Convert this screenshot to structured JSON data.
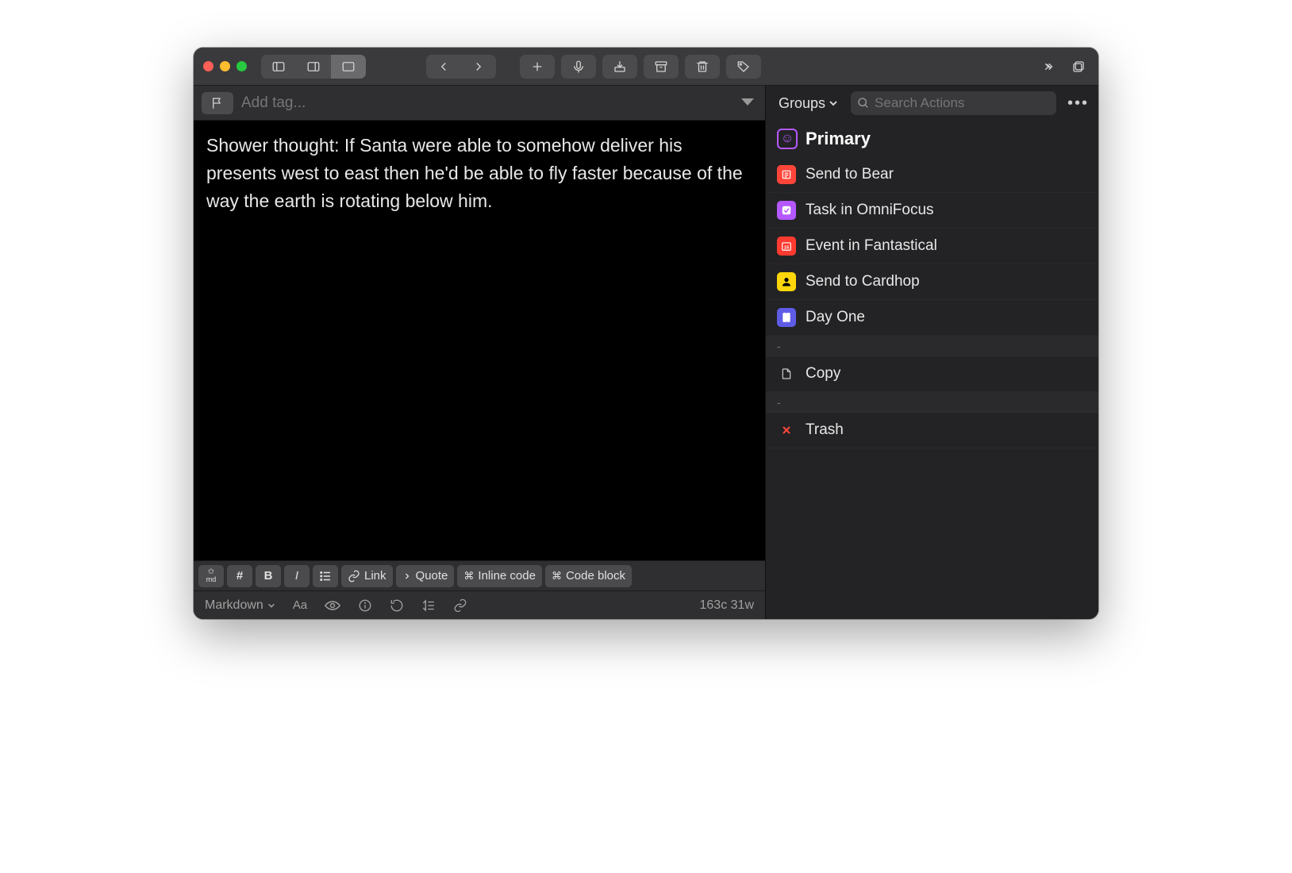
{
  "tagbar": {
    "placeholder": "Add tag..."
  },
  "editor": {
    "text": "Shower thought: If Santa were able to somehow deliver his presents west to east then he'd be able to fly faster because of the way the earth is rotating below him."
  },
  "fmt": {
    "link": "Link",
    "quote": "Quote",
    "inline_code": "Inline code",
    "code_block": "Code block"
  },
  "status": {
    "mode": "Markdown",
    "count": "163c 31w"
  },
  "right": {
    "groups_label": "Groups",
    "search_placeholder": "Search Actions",
    "group_title": "Primary",
    "actions": [
      {
        "label": "Send to Bear",
        "iconBg": "#ff453a",
        "iconFg": "#ffffff",
        "icon": "note"
      },
      {
        "label": "Task in OmniFocus",
        "iconBg": "#b558ff",
        "iconFg": "#ffffff",
        "icon": "check"
      },
      {
        "label": "Event in Fantastical",
        "iconBg": "#ff3b30",
        "iconFg": "#ffffff",
        "icon": "cal"
      },
      {
        "label": "Send to Cardhop",
        "iconBg": "#ffd60a",
        "iconFg": "#000000",
        "icon": "person"
      },
      {
        "label": "Day One",
        "iconBg": "#5e5ce6",
        "iconFg": "#ffffff",
        "icon": "book"
      }
    ],
    "copy_label": "Copy",
    "trash_label": "Trash",
    "sep": "-"
  }
}
